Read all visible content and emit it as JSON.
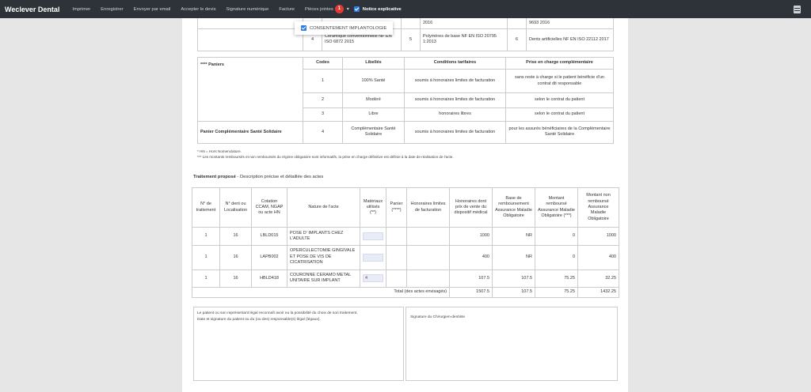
{
  "app": {
    "brand": "Weclever Dental"
  },
  "toolbar": {
    "items": [
      "Imprimer",
      "Enregistrer",
      "Envoyer par email",
      "Accepter le devis",
      "Signature numérique",
      "Facture"
    ],
    "attachments_label": "Pièces jointes",
    "attachments_count": "1",
    "notice_label": "Notice explicative"
  },
  "dropdown": {
    "item_label": "CONSENTEMENT IMPLANTOLOGIE"
  },
  "materials_table": {
    "rows": [
      {
        "c1": "",
        "c2": "",
        "c3": "2016",
        "c4": "",
        "c5": "9693 2016"
      },
      {
        "c1": "4",
        "c2": "Céramique conventionnelle NF EN ISO 6872 2015",
        "c3": "5",
        "c4": "Polymères de base NF EN ISO 20795 1:2013",
        "c5": "6",
        "c6": "Dents artificielles NF EN ISO 22112 2017"
      }
    ]
  },
  "baskets_table": {
    "headers": [
      "**** Paniers",
      "Codes",
      "Libellés",
      "Conditions tarifaires",
      "Prise en charge complémentaire"
    ],
    "rows": [
      {
        "code": "1",
        "label": "100% Santé",
        "cond": "soumis à honoraires limites de facturation",
        "cover": "sans reste à charge si le patient bénéficie d'un contrat dit responsable"
      },
      {
        "code": "2",
        "label": "Modéré",
        "cond": "soumis à honoraires limites de facturation",
        "cover": "selon le contrat du patient"
      },
      {
        "code": "3",
        "label": "Libre",
        "cond": "honoraires libres",
        "cover": "selon le contrat du patient"
      }
    ],
    "css_row": {
      "name": "Panier Complémentaire Santé Solidaire",
      "code": "4",
      "label": "Complémentaire Santé Solidaire",
      "cond": "soumis à honoraires limites de facturation",
      "cover": "pour les assurés bénéficiaires de la Complémentaire Santé Solidaire"
    }
  },
  "footnotes": {
    "hn": "* HN = Hors Nomenclature.",
    "amounts": "*** Les montants remboursés et non remboursés du régime obligatoire sont informatifs, la prise en charge définitive est définie à la date de réalisation de l'acte."
  },
  "treatment": {
    "title_bold": "Traitement proposé",
    "title_rest": " - Description précise et détaillée des actes",
    "headers": [
      "N° de traitement",
      "N° dent ou Localisation",
      "Cotation CCAM, NGAP ou acte HN",
      "Nature de l'acte",
      "Matériaux utilisés (**)",
      "Panier (****)",
      "Honoraires limites de facturation",
      "Honoraires dont prix de vente du dispositif médical",
      "Base de remboursement Assurance Maladie Obligatoire",
      "Montant remboursé Assurance Maladie Obligatoire (***)",
      "Montant non remboursé Assurance Maladie Obligatoire"
    ],
    "rows": [
      {
        "num": "1",
        "tooth": "16",
        "code": "LBLD015",
        "nature": "POSE D' IMPLANTS CHEZ L'ADULTE",
        "mat": "",
        "basket": "",
        "limit": "",
        "fees": "1000",
        "base": "NR",
        "reimb": "0",
        "nonreimb": "1000"
      },
      {
        "num": "1",
        "tooth": "16",
        "code": "LAPB002",
        "nature": "OPERCULECTOMIE GINGIVALE ET POSE DE VIS DE CICATRISATION",
        "mat": "",
        "basket": "",
        "limit": "",
        "fees": "400",
        "base": "NR",
        "reimb": "0",
        "nonreimb": "400"
      },
      {
        "num": "1",
        "tooth": "16",
        "code": "HBLD418",
        "nature": "COURONNE CERAMO METAL UNITAIRE SUR IMPLANT",
        "mat": "4",
        "basket": "",
        "limit": "",
        "fees": "107.5",
        "base": "107.5",
        "reimb": "75.25",
        "nonreimb": "32.25"
      }
    ],
    "total": {
      "label": "Total (des actes envisagés)",
      "fees": "1507.5",
      "base": "107.5",
      "reimb": "75.25",
      "nonreimb": "1432.25"
    }
  },
  "signature": {
    "patient_line1": "Le patient ou son représentant légal reconnaît avoir eu la possibilité du choix de son traitement.",
    "patient_line2": "Date et signature du patient ou du (ou des) responsable(s) légal (légaux).",
    "dentist": "Signature du Chirurgien-dentiste"
  }
}
